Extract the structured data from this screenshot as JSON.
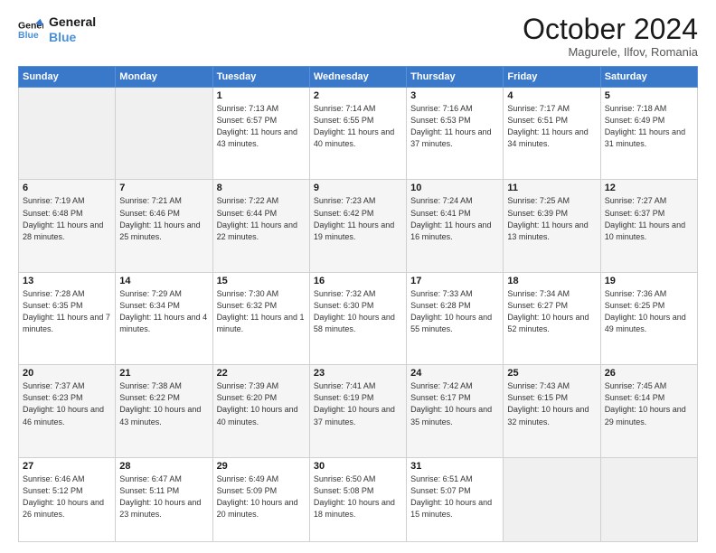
{
  "header": {
    "logo_line1": "General",
    "logo_line2": "Blue",
    "month": "October 2024",
    "location": "Magurele, Ilfov, Romania"
  },
  "weekdays": [
    "Sunday",
    "Monday",
    "Tuesday",
    "Wednesday",
    "Thursday",
    "Friday",
    "Saturday"
  ],
  "weeks": [
    [
      {
        "day": "",
        "info": ""
      },
      {
        "day": "",
        "info": ""
      },
      {
        "day": "1",
        "info": "Sunrise: 7:13 AM\nSunset: 6:57 PM\nDaylight: 11 hours and 43 minutes."
      },
      {
        "day": "2",
        "info": "Sunrise: 7:14 AM\nSunset: 6:55 PM\nDaylight: 11 hours and 40 minutes."
      },
      {
        "day": "3",
        "info": "Sunrise: 7:16 AM\nSunset: 6:53 PM\nDaylight: 11 hours and 37 minutes."
      },
      {
        "day": "4",
        "info": "Sunrise: 7:17 AM\nSunset: 6:51 PM\nDaylight: 11 hours and 34 minutes."
      },
      {
        "day": "5",
        "info": "Sunrise: 7:18 AM\nSunset: 6:49 PM\nDaylight: 11 hours and 31 minutes."
      }
    ],
    [
      {
        "day": "6",
        "info": "Sunrise: 7:19 AM\nSunset: 6:48 PM\nDaylight: 11 hours and 28 minutes."
      },
      {
        "day": "7",
        "info": "Sunrise: 7:21 AM\nSunset: 6:46 PM\nDaylight: 11 hours and 25 minutes."
      },
      {
        "day": "8",
        "info": "Sunrise: 7:22 AM\nSunset: 6:44 PM\nDaylight: 11 hours and 22 minutes."
      },
      {
        "day": "9",
        "info": "Sunrise: 7:23 AM\nSunset: 6:42 PM\nDaylight: 11 hours and 19 minutes."
      },
      {
        "day": "10",
        "info": "Sunrise: 7:24 AM\nSunset: 6:41 PM\nDaylight: 11 hours and 16 minutes."
      },
      {
        "day": "11",
        "info": "Sunrise: 7:25 AM\nSunset: 6:39 PM\nDaylight: 11 hours and 13 minutes."
      },
      {
        "day": "12",
        "info": "Sunrise: 7:27 AM\nSunset: 6:37 PM\nDaylight: 11 hours and 10 minutes."
      }
    ],
    [
      {
        "day": "13",
        "info": "Sunrise: 7:28 AM\nSunset: 6:35 PM\nDaylight: 11 hours and 7 minutes."
      },
      {
        "day": "14",
        "info": "Sunrise: 7:29 AM\nSunset: 6:34 PM\nDaylight: 11 hours and 4 minutes."
      },
      {
        "day": "15",
        "info": "Sunrise: 7:30 AM\nSunset: 6:32 PM\nDaylight: 11 hours and 1 minute."
      },
      {
        "day": "16",
        "info": "Sunrise: 7:32 AM\nSunset: 6:30 PM\nDaylight: 10 hours and 58 minutes."
      },
      {
        "day": "17",
        "info": "Sunrise: 7:33 AM\nSunset: 6:28 PM\nDaylight: 10 hours and 55 minutes."
      },
      {
        "day": "18",
        "info": "Sunrise: 7:34 AM\nSunset: 6:27 PM\nDaylight: 10 hours and 52 minutes."
      },
      {
        "day": "19",
        "info": "Sunrise: 7:36 AM\nSunset: 6:25 PM\nDaylight: 10 hours and 49 minutes."
      }
    ],
    [
      {
        "day": "20",
        "info": "Sunrise: 7:37 AM\nSunset: 6:23 PM\nDaylight: 10 hours and 46 minutes."
      },
      {
        "day": "21",
        "info": "Sunrise: 7:38 AM\nSunset: 6:22 PM\nDaylight: 10 hours and 43 minutes."
      },
      {
        "day": "22",
        "info": "Sunrise: 7:39 AM\nSunset: 6:20 PM\nDaylight: 10 hours and 40 minutes."
      },
      {
        "day": "23",
        "info": "Sunrise: 7:41 AM\nSunset: 6:19 PM\nDaylight: 10 hours and 37 minutes."
      },
      {
        "day": "24",
        "info": "Sunrise: 7:42 AM\nSunset: 6:17 PM\nDaylight: 10 hours and 35 minutes."
      },
      {
        "day": "25",
        "info": "Sunrise: 7:43 AM\nSunset: 6:15 PM\nDaylight: 10 hours and 32 minutes."
      },
      {
        "day": "26",
        "info": "Sunrise: 7:45 AM\nSunset: 6:14 PM\nDaylight: 10 hours and 29 minutes."
      }
    ],
    [
      {
        "day": "27",
        "info": "Sunrise: 6:46 AM\nSunset: 5:12 PM\nDaylight: 10 hours and 26 minutes."
      },
      {
        "day": "28",
        "info": "Sunrise: 6:47 AM\nSunset: 5:11 PM\nDaylight: 10 hours and 23 minutes."
      },
      {
        "day": "29",
        "info": "Sunrise: 6:49 AM\nSunset: 5:09 PM\nDaylight: 10 hours and 20 minutes."
      },
      {
        "day": "30",
        "info": "Sunrise: 6:50 AM\nSunset: 5:08 PM\nDaylight: 10 hours and 18 minutes."
      },
      {
        "day": "31",
        "info": "Sunrise: 6:51 AM\nSunset: 5:07 PM\nDaylight: 10 hours and 15 minutes."
      },
      {
        "day": "",
        "info": ""
      },
      {
        "day": "",
        "info": ""
      }
    ]
  ]
}
